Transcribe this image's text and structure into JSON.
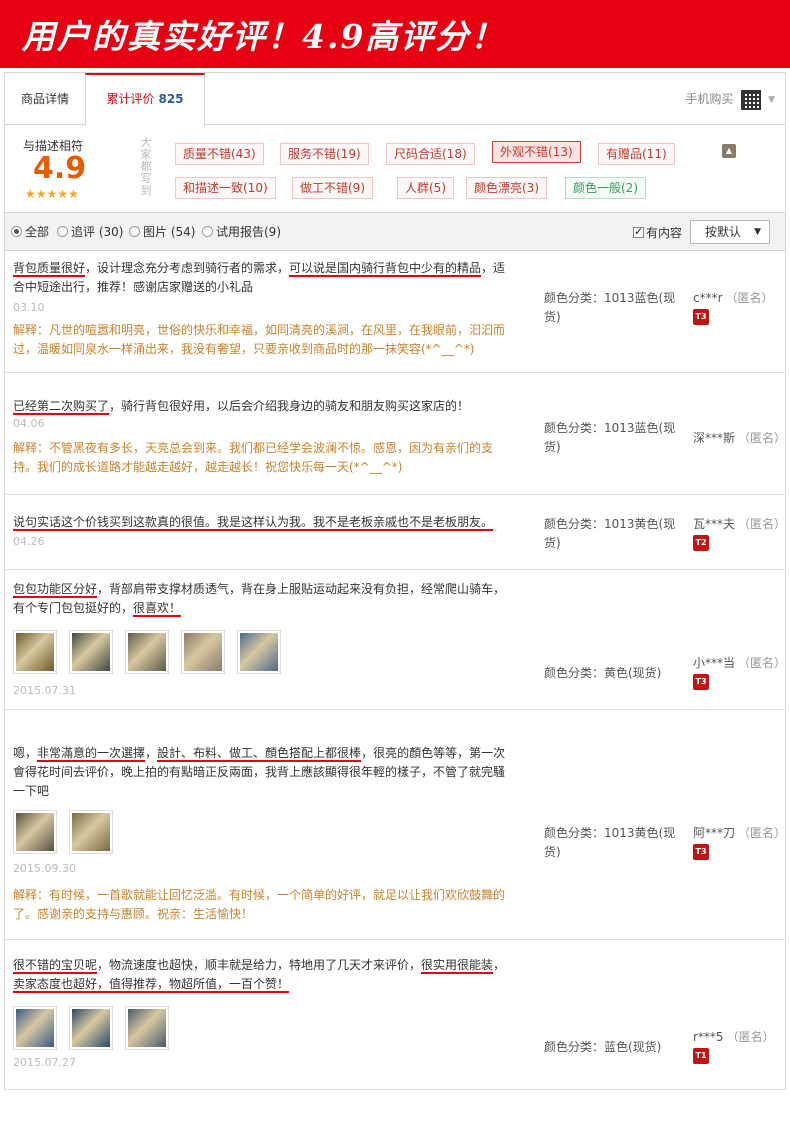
{
  "banner": {
    "title": "用户的真实好评！4.9高评分！",
    "bg": "#e60012"
  },
  "tabs": {
    "detail": "商品详情",
    "reviews": "累计评价",
    "reviews_count": "825",
    "mobile_buy": "手机购买"
  },
  "summary": {
    "score_label": "与描述相符",
    "score": "4.9",
    "stars": "★★★★★",
    "everyone_says": "大家都写到",
    "tags": [
      {
        "label": "质量不错(43)"
      },
      {
        "label": "服务不错(19)"
      },
      {
        "label": "尺码合适(18)"
      },
      {
        "label": "外观不错(13)",
        "selected": true
      },
      {
        "label": "有赠品(11)"
      },
      {
        "label": "和描述一致(10)"
      },
      {
        "label": "做工不错(9)"
      },
      {
        "label": "人群(5)"
      },
      {
        "label": "颜色漂亮(3)"
      },
      {
        "label": "颜色一般(2)",
        "negative": true
      }
    ]
  },
  "filters": {
    "all": "全部",
    "followup": "追评 (30)",
    "pictures": "图片 (54)",
    "trial": "试用报告(9)",
    "has_content": "有内容",
    "sort": "按默认"
  },
  "reviews": [
    {
      "text_parts": [
        {
          "t": "背包质量很好",
          "hl": true
        },
        {
          "t": "，设计理念充分考虑到骑行者的需求，"
        },
        {
          "t": "可以说是国内骑行背包中少有的精品",
          "hl": true
        },
        {
          "t": "，适合中短途出行，推荐！感谢店家赠送的小礼品"
        }
      ],
      "date": "03.10",
      "reply": "解释：凡世的喧嚣和明亮，世俗的快乐和幸福，如同清亮的溪涧，在风里，在我眼前，汩汩而过，温暖如同泉水一样涌出来，我没有奢望，只要亲收到商品时的那一抹笑容(*^__^*)",
      "sku": "颜色分类：1013蓝色(现货)",
      "user": "c***r",
      "anon": "（匿名）",
      "level": "T3"
    },
    {
      "text_parts": [
        {
          "t": "已经第二次购买了",
          "hl": true
        },
        {
          "t": "，骑行背包很好用，以后会介绍我身边的骑友和朋友购买这家店的！"
        }
      ],
      "date": "04.06",
      "reply": "解释：不管黑夜有多长，天亮总会到来。我们都已经学会波澜不惊。感恩，因为有亲们的支持。我们的成长道路才能越走越好，越走越长！祝您快乐每一天(*^__^*)",
      "sku": "颜色分类：1013蓝色(现货)",
      "user": "深***斯",
      "anon": "（匿名）"
    },
    {
      "text_parts": [
        {
          "t": "说句实话这个价钱买到这款真的很值。我是这样认为我。我不是老板亲戚也不是老板朋友。",
          "hl": true
        }
      ],
      "date": "04.26",
      "sku": "颜色分类：1013黄色(现货)",
      "user": "瓦***夫",
      "anon": "（匿名）",
      "level": "T2"
    },
    {
      "text_parts": [
        {
          "t": "包包功能区分好",
          "hl": true
        },
        {
          "t": "，背部肩带支撑材质透气，背在身上服贴运动起来没有负担，经常爬山骑车，有个专门包包挺好的，"
        },
        {
          "t": "很喜欢！",
          "hl": true
        }
      ],
      "date": "2015.07.31",
      "sku": "颜色分类：黄色(现货)",
      "user": "小***当",
      "anon": "（匿名）",
      "level": "T3",
      "thumbs": [
        "#6b5a2a",
        "#3d4a3a",
        "#5b5b4a",
        "#8a7a6a",
        "#4a6a8a"
      ]
    },
    {
      "text_parts": [
        {
          "t": "嗯，"
        },
        {
          "t": "非常滿意的一次選擇",
          "hl": true
        },
        {
          "t": "，"
        },
        {
          "t": "設計、布料、做工、顏色搭配上都很棒",
          "hl": true
        },
        {
          "t": "，很亮的顏色等等，第一次會得花时间去评价，晚上拍的有點暗正反兩面，我背上應該顯得很年輕的樣子，不管了就完騷一下吧"
        }
      ],
      "date": "2015.09.30",
      "reply": "解释：有时候，一首歌就能让回忆泛滥。有时候，一个简单的好评，就足以让我们欢欣鼓舞的了。感谢亲的支持与惠顾。祝亲：生活愉快！",
      "sku": "颜色分类：1013黄色(现货)",
      "user": "阿***刀",
      "anon": "（匿名）",
      "level": "T3",
      "thumbs": [
        "#5a5040",
        "#7a6a40"
      ]
    },
    {
      "text_parts": [
        {
          "t": "很不错的宝贝呢",
          "hl": true
        },
        {
          "t": "，物流速度也超快，顺丰就是给力，特地用了几天才来评价，"
        },
        {
          "t": "很实用很能装",
          "hl": true
        },
        {
          "t": "，"
        },
        {
          "t": "卖家态度也超好，值得推荐，物超所值，一百个赞！",
          "hl": true
        }
      ],
      "date": "2015.07.27",
      "sku": "颜色分类：蓝色(现货)",
      "user": "r***5",
      "anon": "（匿名）",
      "level": "T1",
      "thumbs": [
        "#3a5a8a",
        "#2a4a6a",
        "#4a5a6a"
      ]
    }
  ]
}
